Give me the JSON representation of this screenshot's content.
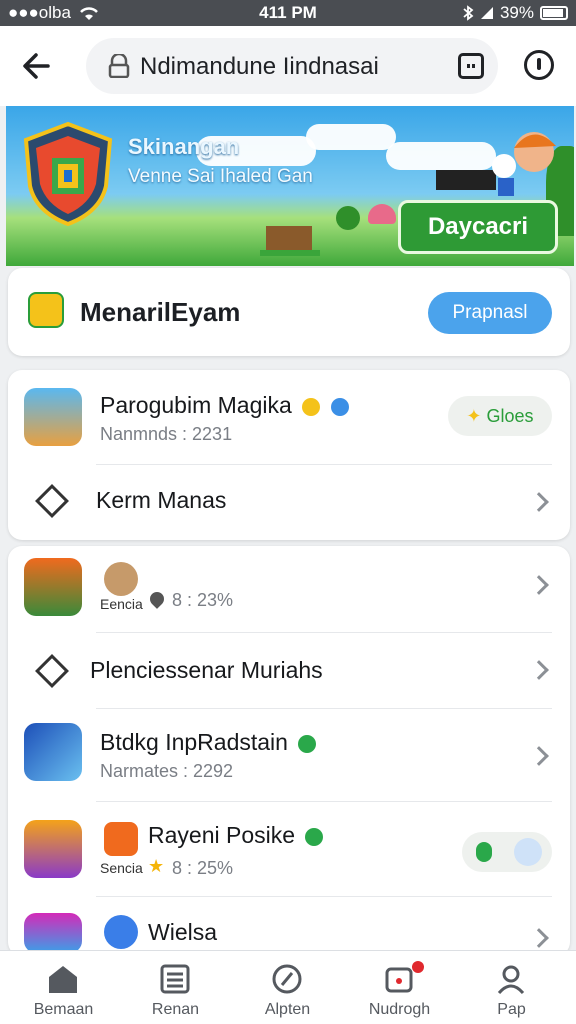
{
  "status_bar": {
    "carrier": "●●●olba",
    "time": "411 PM",
    "battery": "39%"
  },
  "browser": {
    "url": "Ndimandune Iindnasai"
  },
  "banner": {
    "title": "Skinangan",
    "subtitle": "Venne Sai Ihaled Gan",
    "play_label": "Daycacri"
  },
  "app": {
    "name": "MenarilEyam",
    "action_label": "Prapnasl"
  },
  "list_1": [
    {
      "title": "Parogubim Magika",
      "subtitle": "Nanmnds : 2231",
      "action_label": "Gloes"
    },
    {
      "title": "Kerm Manas"
    }
  ],
  "list_2": [
    {
      "label": "Eencia",
      "meta": "8 : 23%"
    },
    {
      "title": "Plenciessenar Muriahs"
    },
    {
      "title": "Btdkg InpRadstain",
      "subtitle": "Narmates : 2292"
    },
    {
      "title": "Rayeni Posike",
      "label": "Sencia",
      "meta": "8 : 25%"
    },
    {
      "title": "Wielsa"
    }
  ],
  "bottom_nav": [
    {
      "label": "Bemaan",
      "icon": "home-icon"
    },
    {
      "label": "Renan",
      "icon": "list-icon"
    },
    {
      "label": "Alpten",
      "icon": "compass-icon"
    },
    {
      "label": "Nudrogh",
      "icon": "notification-icon"
    },
    {
      "label": "Pap",
      "icon": "profile-icon"
    }
  ],
  "colors": {
    "primary": "#4ba3ec",
    "play": "#2e9a35",
    "status_bar": "#4a4d52"
  }
}
